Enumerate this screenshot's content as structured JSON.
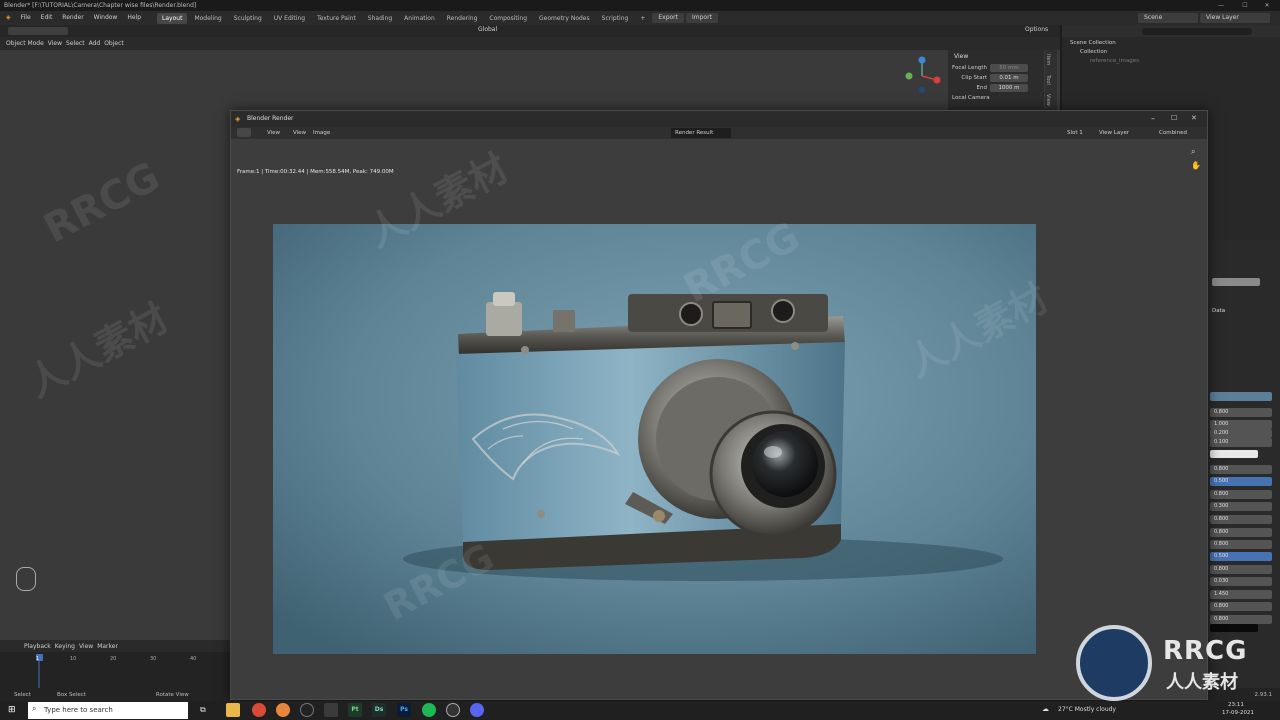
{
  "window": {
    "title": "Blender* [F:\\TUTORIAL\\Camera\\Chapter wise files\\Render.blend]",
    "min": "—",
    "max": "☐",
    "close": "✕"
  },
  "menu": [
    "File",
    "Edit",
    "Render",
    "Window",
    "Help"
  ],
  "workspaces": [
    "Layout",
    "Modeling",
    "Sculpting",
    "UV Editing",
    "Texture Paint",
    "Shading",
    "Animation",
    "Rendering",
    "Compositing",
    "Geometry Nodes",
    "Scripting"
  ],
  "topbar": {
    "export_label": "Export",
    "import_label": "Import",
    "scene": "Scene",
    "view_layer": "View Layer"
  },
  "viewport": {
    "mode": "Object Mode",
    "menus": [
      "View",
      "Select",
      "Add",
      "Object"
    ],
    "orientation": "Global",
    "options_label": "Options"
  },
  "npanel": {
    "section": "View",
    "focal_length_label": "Focal Length",
    "focal_length_value": "50 mm",
    "clip_start_label": "Clip Start",
    "clip_start_value": "0.01 m",
    "end_label": "End",
    "end_value": "1000 m",
    "local_camera_label": "Local Camera",
    "tabs": [
      "Item",
      "Tool",
      "View"
    ]
  },
  "outliner": {
    "scene_collection": "Scene Collection",
    "collection": "Collection",
    "reference": "reference_images"
  },
  "render_window": {
    "title": "Blender Render",
    "menus": [
      "View",
      "View",
      "Image"
    ],
    "result": "Render Result",
    "slot": "Slot 1",
    "view_layer": "View Layer",
    "pass": "Combined",
    "meta": "Frame:1 | Time:00:32.44 | Mem:558.54M, Peak: 749.00M"
  },
  "properties": {
    "data_label": "Data",
    "values": [
      "0.800",
      "1.000",
      "0.200",
      "0.100",
      "0.800",
      "0.500",
      "0.800",
      "0.300",
      "0.800",
      "0.800",
      "0.800",
      "0.500",
      "0.800",
      "0.030",
      "1.450",
      "0.800",
      "0.800"
    ],
    "active_indices": [
      5,
      11
    ]
  },
  "timeline": {
    "menus": [
      "Playback",
      "Keying",
      "View",
      "Marker"
    ],
    "frames": [
      "1",
      "10",
      "20",
      "30",
      "40"
    ]
  },
  "statusbar": {
    "select": "Select",
    "box_select": "Box Select",
    "rotate_view": "Rotate View",
    "version": "2.93.1"
  },
  "taskbar": {
    "search_placeholder": "Type here to search",
    "weather": "27°C  Mostly cloudy",
    "time": "23:11",
    "date": "17-09-2021",
    "apps": [
      "Pt",
      "Ds",
      "Ps"
    ]
  },
  "watermark": {
    "brand": "RRCG",
    "cn": "人人素材"
  },
  "colors": {
    "accent": "#4772b3",
    "render_bg": "#6a8fa0"
  }
}
